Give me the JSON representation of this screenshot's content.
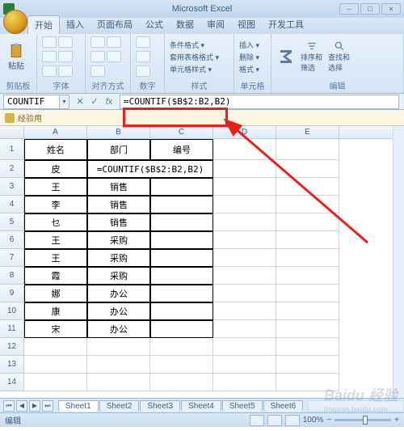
{
  "app_title": "Microsoft Excel",
  "tabs": [
    "开始",
    "插入",
    "页面布局",
    "公式",
    "数据",
    "审阅",
    "视图",
    "开发工具"
  ],
  "active_tab_index": 0,
  "ribbon_groups": {
    "clipboard": {
      "label": "剪贴板",
      "paste": "粘贴"
    },
    "font": {
      "label": "字体"
    },
    "align": {
      "label": "对齐方式"
    },
    "number": {
      "label": "数字"
    },
    "styles": {
      "label": "样式",
      "cond": "条件格式 ▾",
      "tbl": "套用表格格式 ▾",
      "cell": "单元格样式 ▾"
    },
    "cells": {
      "label": "单元格",
      "ins": "插入 ▾",
      "del": "删除 ▾",
      "fmt": "格式 ▾"
    },
    "editing": {
      "label": "编辑",
      "sort": "排序和筛选",
      "find": "查找和选择"
    }
  },
  "namebox": "COUNTIF",
  "formula": "=COUNTIF($B$2:B2,B2)",
  "security_msg": "经验用",
  "columns": [
    {
      "id": "A",
      "w": 78
    },
    {
      "id": "B",
      "w": 78
    },
    {
      "id": "C",
      "w": 78
    },
    {
      "id": "D",
      "w": 78
    },
    {
      "id": "E",
      "w": 78
    }
  ],
  "sheet": {
    "headers": {
      "c1": "姓名",
      "c2": "部门",
      "c3": "编号"
    },
    "merged_formula": "=COUNTIF($B$2:B2,B2)",
    "rows": [
      {
        "n": "皮",
        "d": ""
      },
      {
        "n": "王",
        "d": "销售"
      },
      {
        "n": "李",
        "d": "销售"
      },
      {
        "n": "乜",
        "d": "销售"
      },
      {
        "n": "王",
        "d": "采购"
      },
      {
        "n": "王",
        "d": "采购"
      },
      {
        "n": "霞",
        "d": "采购"
      },
      {
        "n": "娜",
        "d": "办公"
      },
      {
        "n": "康",
        "d": "办公"
      },
      {
        "n": "宋",
        "d": "办公"
      }
    ]
  },
  "sheet_tabs": [
    "Sheet1",
    "Sheet2",
    "Sheet3",
    "Sheet4",
    "Sheet5",
    "Sheet6"
  ],
  "status_text": "编辑",
  "zoom": "100%",
  "watermark": {
    "brand": "Baidu 经验",
    "url": "jingyan.baidu.com"
  }
}
